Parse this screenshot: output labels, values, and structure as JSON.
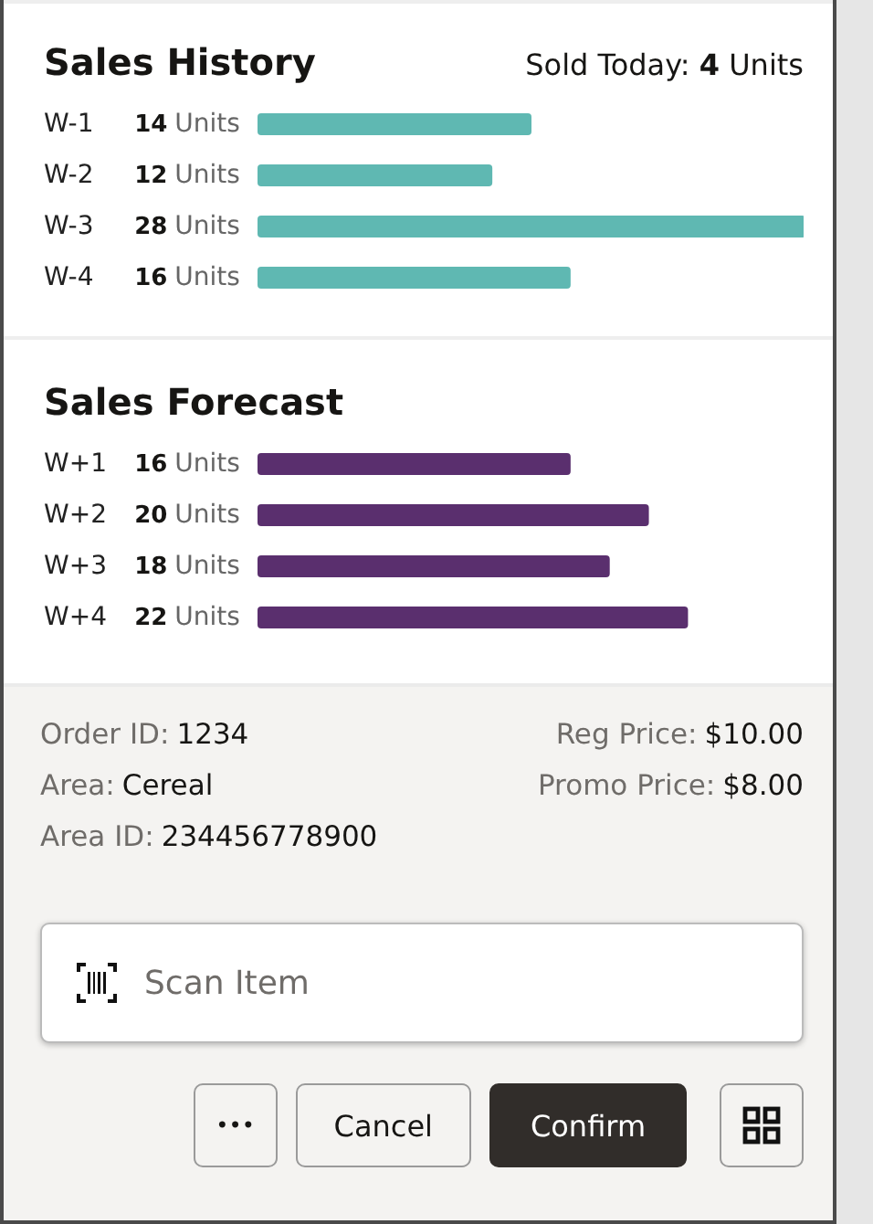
{
  "history": {
    "title": "Sales History",
    "sold_today": "Sold Today: **4** Units",
    "unit_labels": [
      "Units",
      "Units",
      "Units",
      "Units"
    ],
    "chart_data": {
      "type": "bar",
      "orientation": "horizontal",
      "categories": [
        "W-1",
        "W-2",
        "W-3",
        "W-4"
      ],
      "values": [
        14,
        12,
        28,
        16
      ],
      "value_labels": [
        "14",
        "12",
        "28",
        "16"
      ]
    }
  },
  "forecast": {
    "title": "Sales Forecast",
    "unit_labels": [
      "Units",
      "Units",
      "Units",
      "Units"
    ],
    "chart_data": {
      "type": "bar",
      "orientation": "horizontal",
      "categories": [
        "W+1",
        "W+2",
        "W+3",
        "W+4"
      ],
      "values": [
        16,
        20,
        18,
        22
      ],
      "value_labels": [
        "16",
        "20",
        "18",
        "22"
      ]
    }
  },
  "details": {
    "left": [
      {
        "label": "Order ID:",
        "value": "1234"
      },
      {
        "label": "Area:",
        "value": "Cereal"
      },
      {
        "label": "Area ID:",
        "value": "234456778900"
      }
    ],
    "right": [
      {
        "label": "Reg Price:",
        "value": "$10.00"
      },
      {
        "label": "Promo Price:",
        "value": "$8.00"
      }
    ]
  },
  "scan": {
    "placeholder": "Scan Item"
  },
  "buttons": {
    "more": "•••",
    "cancel": "Cancel",
    "confirm": "Confirm"
  }
}
